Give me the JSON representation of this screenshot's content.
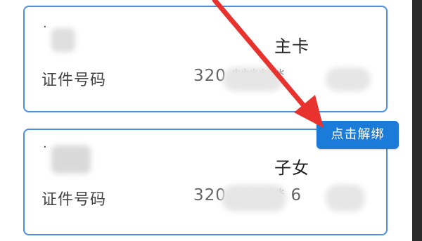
{
  "cards": [
    {
      "role": "主卡",
      "id_label": "证件号码",
      "id_value": "320                ******                "
    },
    {
      "role": "子女",
      "id_label": "证件号码",
      "id_value": "320                ******                6"
    }
  ],
  "unbind_button": {
    "label": "点击解绑"
  },
  "colors": {
    "card_border": "#4a90e2",
    "button_bg": "#1a7bd8",
    "arrow": "#e8322d"
  },
  "icons": {
    "annotation": "red-arrow-icon"
  }
}
